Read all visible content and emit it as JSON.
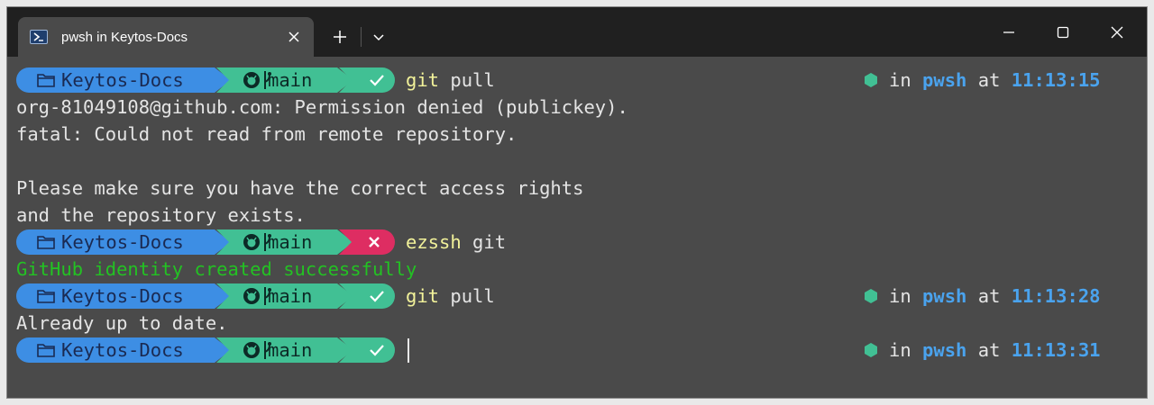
{
  "tab": {
    "title": "pwsh in Keytos-Docs",
    "icon": "powershell-icon"
  },
  "toolbar": {
    "new_tab": "+",
    "dropdown": "chevron-down"
  },
  "prompt": {
    "dir": "Keytos-Docs",
    "branch": "main",
    "in_label": "in",
    "shell": "pwsh",
    "at_label": "at"
  },
  "colors": {
    "dir_segment": "#3d8ee4",
    "git_segment": "#41c094",
    "success_status": "#41c094",
    "error_status": "#de2d62",
    "command": "#f2f29a",
    "time": "#4aa3ee",
    "success_message": "#23c223"
  },
  "lines": [
    {
      "type": "prompt",
      "status": "success",
      "cmd": "git",
      "args": " pull",
      "time": "11:13:15"
    },
    {
      "type": "output",
      "text": "org-81049108@github.com: Permission denied (publickey)."
    },
    {
      "type": "output",
      "text": "fatal: Could not read from remote repository."
    },
    {
      "type": "output",
      "text": ""
    },
    {
      "type": "output",
      "text": "Please make sure you have the correct access rights"
    },
    {
      "type": "output",
      "text": "and the repository exists."
    },
    {
      "type": "prompt",
      "status": "error",
      "cmd": "ezssh",
      "args": " git"
    },
    {
      "type": "output_success",
      "text": "GitHub identity created successfully"
    },
    {
      "type": "prompt",
      "status": "success",
      "cmd": "git",
      "args": " pull",
      "time": "11:13:28"
    },
    {
      "type": "output",
      "text": "Already up to date."
    },
    {
      "type": "prompt",
      "status": "success",
      "cmd": "",
      "args": "",
      "time": "11:13:31",
      "cursor": true
    }
  ]
}
